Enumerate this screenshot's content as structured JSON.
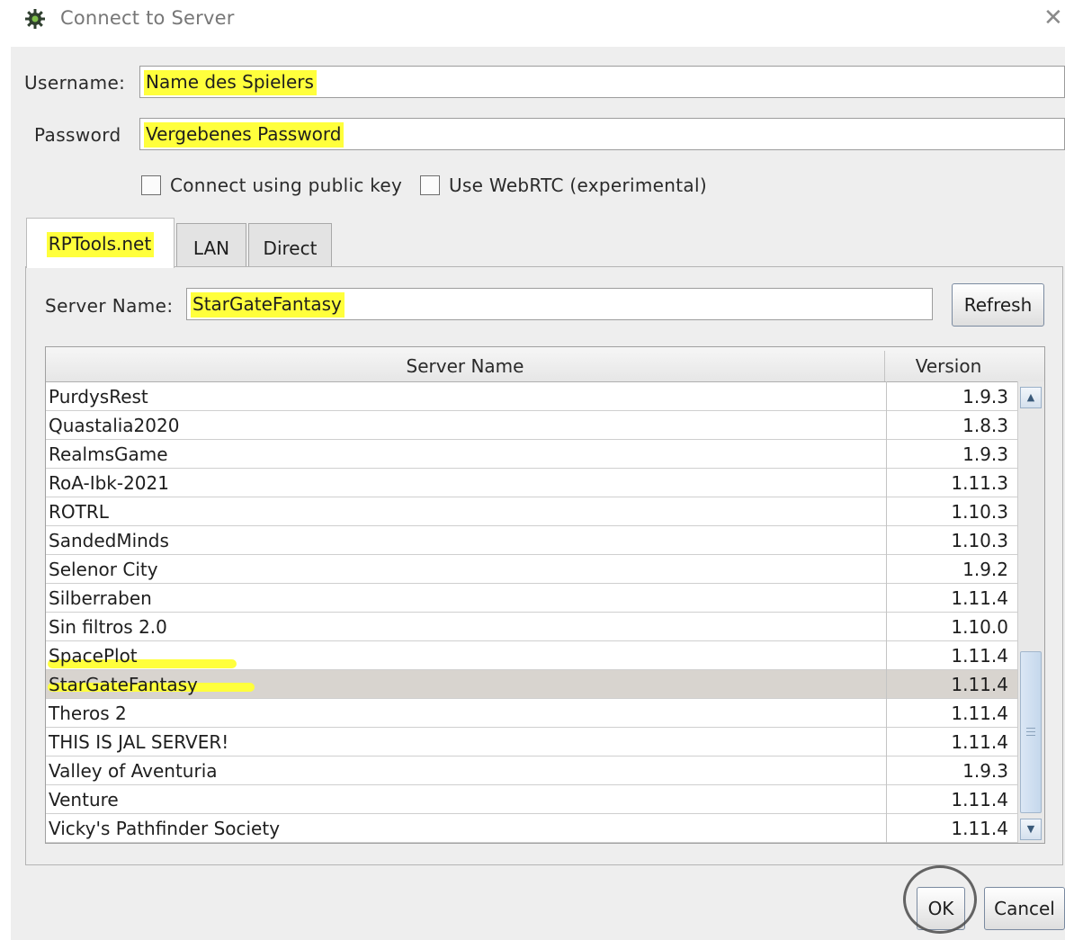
{
  "window": {
    "title": "Connect to Server",
    "close_glyph": "✕",
    "app_icon": "gear-icon"
  },
  "form": {
    "username_label": "Username:",
    "username_value": "Name des Spielers",
    "password_label": "Password",
    "password_value": "Vergebenes Password"
  },
  "options": {
    "public_key": {
      "label": "Connect using public key",
      "checked": false
    },
    "webrtc": {
      "label": "Use WebRTC (experimental)",
      "checked": false
    }
  },
  "tabs": [
    {
      "label": "RPTools.net",
      "active": true
    },
    {
      "label": "LAN",
      "active": false
    },
    {
      "label": "Direct",
      "active": false
    }
  ],
  "rptools": {
    "server_name_label": "Server Name:",
    "server_name_value": "StarGateFantasy",
    "refresh_label": "Refresh",
    "table": {
      "columns": [
        "Server Name",
        "Version"
      ],
      "rows": [
        {
          "name": "PurdysRest",
          "version": "1.9.3"
        },
        {
          "name": "Quastalia2020",
          "version": "1.8.3"
        },
        {
          "name": "RealmsGame",
          "version": "1.9.3"
        },
        {
          "name": "RoA-Ibk-2021",
          "version": "1.11.3"
        },
        {
          "name": "ROTRL",
          "version": "1.10.3"
        },
        {
          "name": "SandedMinds",
          "version": "1.10.3"
        },
        {
          "name": "Selenor City",
          "version": "1.9.2"
        },
        {
          "name": "Silberraben",
          "version": "1.11.4"
        },
        {
          "name": "Sin filtros 2.0",
          "version": "1.10.0"
        },
        {
          "name": "SpacePlot",
          "version": "1.11.4"
        },
        {
          "name": "StarGateFantasy",
          "version": "1.11.4",
          "selected": true
        },
        {
          "name": "Theros 2",
          "version": "1.11.4"
        },
        {
          "name": "THIS IS JAL SERVER!",
          "version": "1.11.4"
        },
        {
          "name": "Valley of Aventuria",
          "version": "1.9.3"
        },
        {
          "name": "Venture",
          "version": "1.11.4"
        },
        {
          "name": "Vicky's Pathfinder Society",
          "version": "1.11.4"
        }
      ]
    }
  },
  "buttons": {
    "ok": "OK",
    "cancel": "Cancel"
  },
  "colors": {
    "highlight": "#ffff3c",
    "dialog_bg": "#eeeeee",
    "selected_row": "#d8d4cf"
  }
}
